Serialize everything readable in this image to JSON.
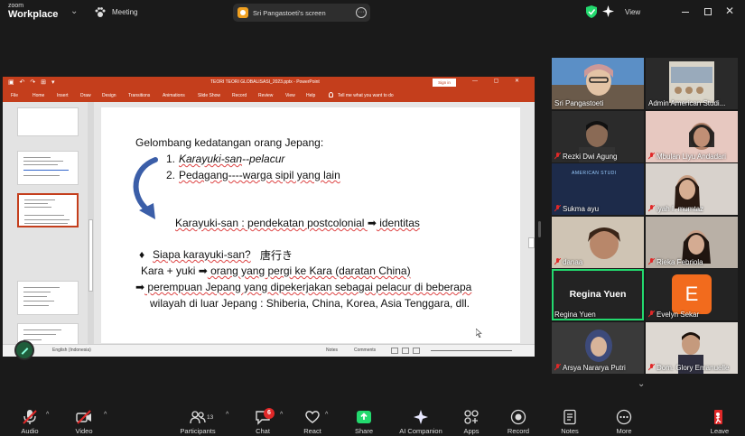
{
  "titlebar": {
    "brand_top": "zoom",
    "brand_bottom": "Workplace",
    "meeting_label": "Meeting",
    "share_text": "Sri Pangastoeti's screen",
    "view_label": "View"
  },
  "powerpoint": {
    "doc_title": "TEORI TEORI GLOBALISASI_2023.pptx  -  PowerPoint",
    "signin": "Sign in",
    "menu": [
      "File",
      "Home",
      "Insert",
      "Draw",
      "Design",
      "Transitions",
      "Animations",
      "Slide Show",
      "Record",
      "Review",
      "View",
      "Help"
    ],
    "tell_me": "Tell me what you want to do",
    "status_lang": "English (Indonesia)",
    "status_notes": "Notes",
    "status_comments": "Comments",
    "slide": {
      "heading": "Gelombang kedatangan orang Jepang:",
      "item1_num": "1.",
      "item1_a": "Karayuki-san",
      "item1_b": "--pelacur",
      "item2_num": "2.",
      "item2": "Pedagang----warga sipil yang lain",
      "approach_a": "Karayuki-san : pendekatan postcolonial ",
      "approach_arrow": "➡",
      "approach_b": " identitas",
      "question_bullet": "♦",
      "question": "Siapa karayuki-san?",
      "kanji": "唐行き",
      "kara_a": "Kara + yuki ",
      "kara_arrow": "➡",
      "kara_b": " orang yang pergi ke Kara (daratan China)",
      "women_arrow": "➡",
      "women_a": " perempuan Jepang yang dipekerjakan sebagai pelacur di beberapa",
      "women_b": "wilayah di luar Jepang : Shiberia, China, Korea, Asia Tenggara, dll."
    }
  },
  "participants": [
    {
      "name": "Sri Pangastoeti",
      "muted": false
    },
    {
      "name": "Admin American Studi...",
      "muted": false
    },
    {
      "name": "Rezki Dwi Agung",
      "muted": true
    },
    {
      "name": "Mbulan Liyu Andadari",
      "muted": true
    },
    {
      "name": "Sukma ayu",
      "muted": true
    },
    {
      "name": "iyah I. mumtaz",
      "muted": true
    },
    {
      "name": "danaa",
      "muted": true
    },
    {
      "name": "Rieka Febriola",
      "muted": true
    },
    {
      "name": "Regina Yuen",
      "muted": false,
      "display": "Regina Yuen"
    },
    {
      "name": "Evelyn Sekar",
      "muted": true,
      "initial": "E"
    },
    {
      "name": "Arsya Nararya Putri",
      "muted": true
    },
    {
      "name": "Dom. Glory Emanuelle",
      "muted": true
    }
  ],
  "tile_overlay": "AMERICAN STUDI",
  "toolbar": {
    "audio": "Audio",
    "video": "Video",
    "participants": "Participants",
    "participants_count": "13",
    "chat": "Chat",
    "chat_badge": "6",
    "react": "React",
    "share": "Share",
    "ai": "AI Companion",
    "apps": "Apps",
    "record": "Record",
    "notes": "Notes",
    "more": "More",
    "leave": "Leave"
  },
  "colors": {
    "ppt_accent": "#c43e1c",
    "zoom_share_green": "#23d96e",
    "evelyn_avatar": "#f26b1d",
    "muted_red": "#e02828"
  }
}
